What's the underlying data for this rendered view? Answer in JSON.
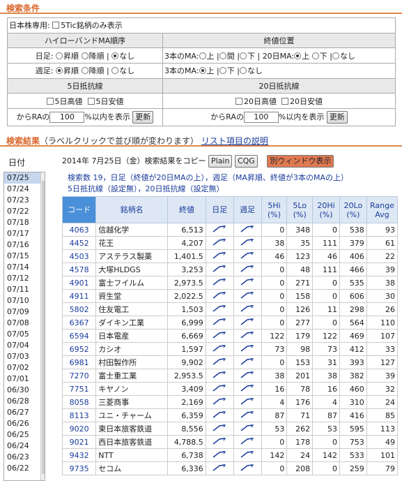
{
  "section_conditions": "検索条件",
  "jp_only_label": "日本株専用:",
  "jp_only_option": "5Tic銘柄のみ表示",
  "hilo_header": "ハイローバンドMA順序",
  "close_header": "終値位置",
  "daily_label": "日足:",
  "weekly_label": "週足:",
  "opt_up": "昇順",
  "opt_down": "降順",
  "opt_none": "なし",
  "sep": "|",
  "ma3_label": "3本のMA:",
  "ma20_label": "20日MA:",
  "pos_up": "上",
  "pos_mid": "間",
  "pos_down": "下",
  "r5_header": "5日抵抗線",
  "r20_header": "20日抵抗線",
  "r5_high": "5日高値",
  "r5_low": "5日安値",
  "r20_high": "20日高値",
  "r20_low": "20日安値",
  "ra_from": "からRAの",
  "ra_value": "100",
  "ra_suffix": "%以内を表示",
  "update_button": "更新",
  "section_results": "検索結果",
  "results_note": "（ラベルクリックで並び順が変わります）",
  "results_link": "リスト項目の説明",
  "date_header": "日付",
  "date_text": "2014年 7月25日（金）検索結果をコピー",
  "btn_plain": "Plain",
  "btn_cqg": "CQG",
  "btn_window": "別ウィンドウ表示",
  "summary_line1": "検索数 19，日足（終値が20日MAの上），週足（MA昇順、終値が3本のMAの上）",
  "summary_line2": "5日抵抗線（設定無），20日抵抗線（設定無）",
  "dates": [
    "07/25",
    "07/24",
    "07/23",
    "07/22",
    "07/18",
    "07/17",
    "07/16",
    "07/15",
    "07/14",
    "07/12",
    "07/11",
    "07/10",
    "07/09",
    "07/08",
    "07/05",
    "07/04",
    "07/03",
    "07/02",
    "07/01",
    "06/30",
    "06/28",
    "06/27",
    "06/26",
    "06/25",
    "06/24",
    "06/23",
    "06/22"
  ],
  "columns": [
    "コード",
    "銘柄名",
    "終値",
    "日足",
    "週足",
    "5Hi\n(%)",
    "5Lo\n(%)",
    "20Hi\n(%)",
    "20Lo\n(%)",
    "Range\nAvg"
  ],
  "rows": [
    [
      "4063",
      "信越化学",
      "6,513",
      "0",
      "348",
      "0",
      "538",
      "93"
    ],
    [
      "4452",
      "花王",
      "4,207",
      "38",
      "35",
      "111",
      "379",
      "61"
    ],
    [
      "4503",
      "アステラス製薬",
      "1,401.5",
      "46",
      "123",
      "46",
      "406",
      "22"
    ],
    [
      "4578",
      "大塚HLDGS",
      "3,253",
      "0",
      "48",
      "111",
      "466",
      "39"
    ],
    [
      "4901",
      "富士フイルム",
      "2,973.5",
      "0",
      "271",
      "0",
      "535",
      "38"
    ],
    [
      "4911",
      "資生堂",
      "2,022.5",
      "0",
      "158",
      "0",
      "606",
      "30"
    ],
    [
      "5802",
      "住友電工",
      "1,503",
      "0",
      "126",
      "11",
      "298",
      "26"
    ],
    [
      "6367",
      "ダイキン工業",
      "6,999",
      "0",
      "277",
      "0",
      "564",
      "110"
    ],
    [
      "6594",
      "日本電産",
      "6,669",
      "122",
      "179",
      "122",
      "469",
      "107"
    ],
    [
      "6952",
      "カシオ",
      "1,597",
      "73",
      "98",
      "73",
      "412",
      "33"
    ],
    [
      "6981",
      "村田製作所",
      "9,902",
      "0",
      "153",
      "31",
      "393",
      "127"
    ],
    [
      "7270",
      "富士重工業",
      "2,953.5",
      "38",
      "201",
      "38",
      "382",
      "39"
    ],
    [
      "7751",
      "キヤノン",
      "3,409",
      "16",
      "78",
      "16",
      "460",
      "32"
    ],
    [
      "8058",
      "三菱商事",
      "2,169",
      "4",
      "176",
      "4",
      "310",
      "24"
    ],
    [
      "8113",
      "ユニ・チャーム",
      "6,359",
      "87",
      "71",
      "87",
      "416",
      "85"
    ],
    [
      "9020",
      "東日本旅客鉄道",
      "8,556",
      "53",
      "262",
      "53",
      "595",
      "113"
    ],
    [
      "9021",
      "西日本旅客鉄道",
      "4,788.5",
      "0",
      "178",
      "0",
      "753",
      "49"
    ],
    [
      "9432",
      "NTT",
      "6,738",
      "142",
      "24",
      "142",
      "533",
      "101"
    ],
    [
      "9735",
      "セコム",
      "6,336",
      "0",
      "208",
      "0",
      "259",
      "79"
    ]
  ]
}
